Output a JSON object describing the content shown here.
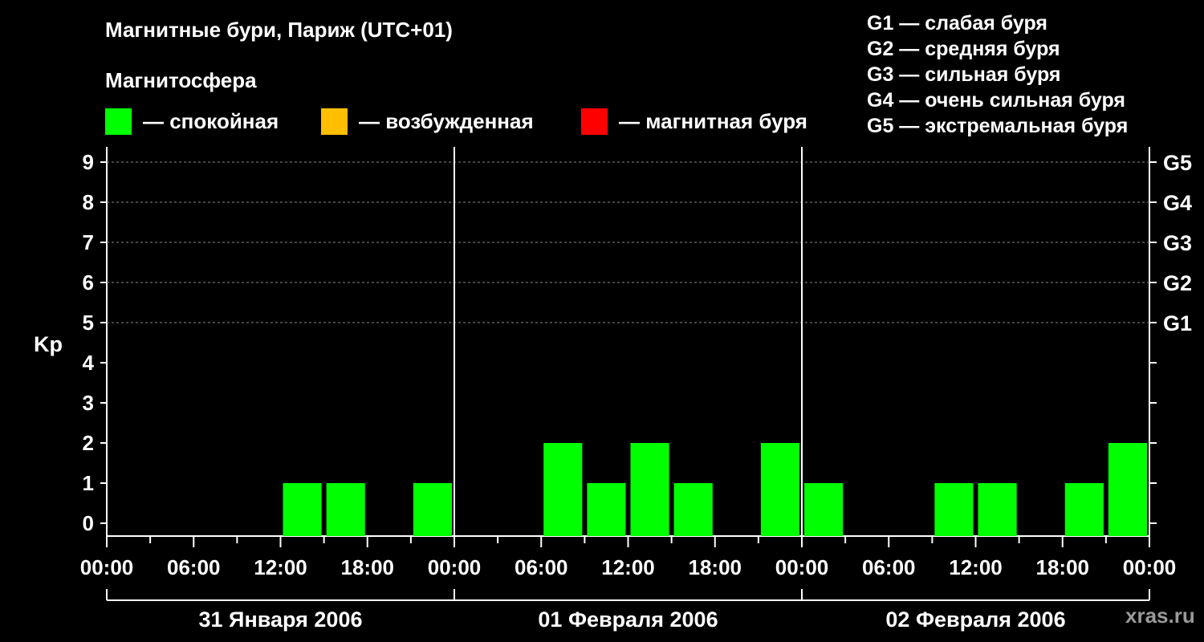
{
  "title": "Магнитные бури, Париж (UTC+01)",
  "subtitle": "Магнитосфера",
  "legend": [
    {
      "color": "#00ff00",
      "label": "— спокойная"
    },
    {
      "color": "#ffbf00",
      "label": "— возбужденная"
    },
    {
      "color": "#ff0000",
      "label": "— магнитная буря"
    }
  ],
  "g_scale_legend": [
    "G1 — слабая буря",
    "G2 — средняя буря",
    "G3 — сильная буря",
    "G4 — очень сильная буря",
    "G5 — экстремальная буря"
  ],
  "watermark": "xras.ru",
  "chart_data": {
    "type": "bar",
    "ylabel": "Kp",
    "ylim": [
      0,
      9
    ],
    "y_ticks": [
      "0",
      "1",
      "2",
      "3",
      "4",
      "5",
      "6",
      "7",
      "8",
      "9"
    ],
    "right_ticks": [
      {
        "kp": 5,
        "label": "G1"
      },
      {
        "kp": 6,
        "label": "G2"
      },
      {
        "kp": 7,
        "label": "G3"
      },
      {
        "kp": 8,
        "label": "G4"
      },
      {
        "kp": 9,
        "label": "G5"
      }
    ],
    "x_tick_labels": [
      "00:00",
      "06:00",
      "12:00",
      "18:00",
      "00:00",
      "06:00",
      "12:00",
      "18:00",
      "00:00",
      "06:00",
      "12:00",
      "18:00",
      "00:00"
    ],
    "days": [
      "31 Января 2006",
      "01 Февраля 2006",
      "02 Февраля 2006"
    ],
    "bar_interval_hours": 3,
    "grid": "dashed horizontal lines at Kp 5–9",
    "series": [
      {
        "values": [
          0,
          0,
          0,
          0,
          1,
          1,
          0,
          1,
          0,
          0,
          2,
          1,
          2,
          1,
          0,
          2,
          1,
          0,
          0,
          1,
          1,
          0,
          1,
          2
        ]
      }
    ],
    "bar_color": "#00ff00"
  }
}
